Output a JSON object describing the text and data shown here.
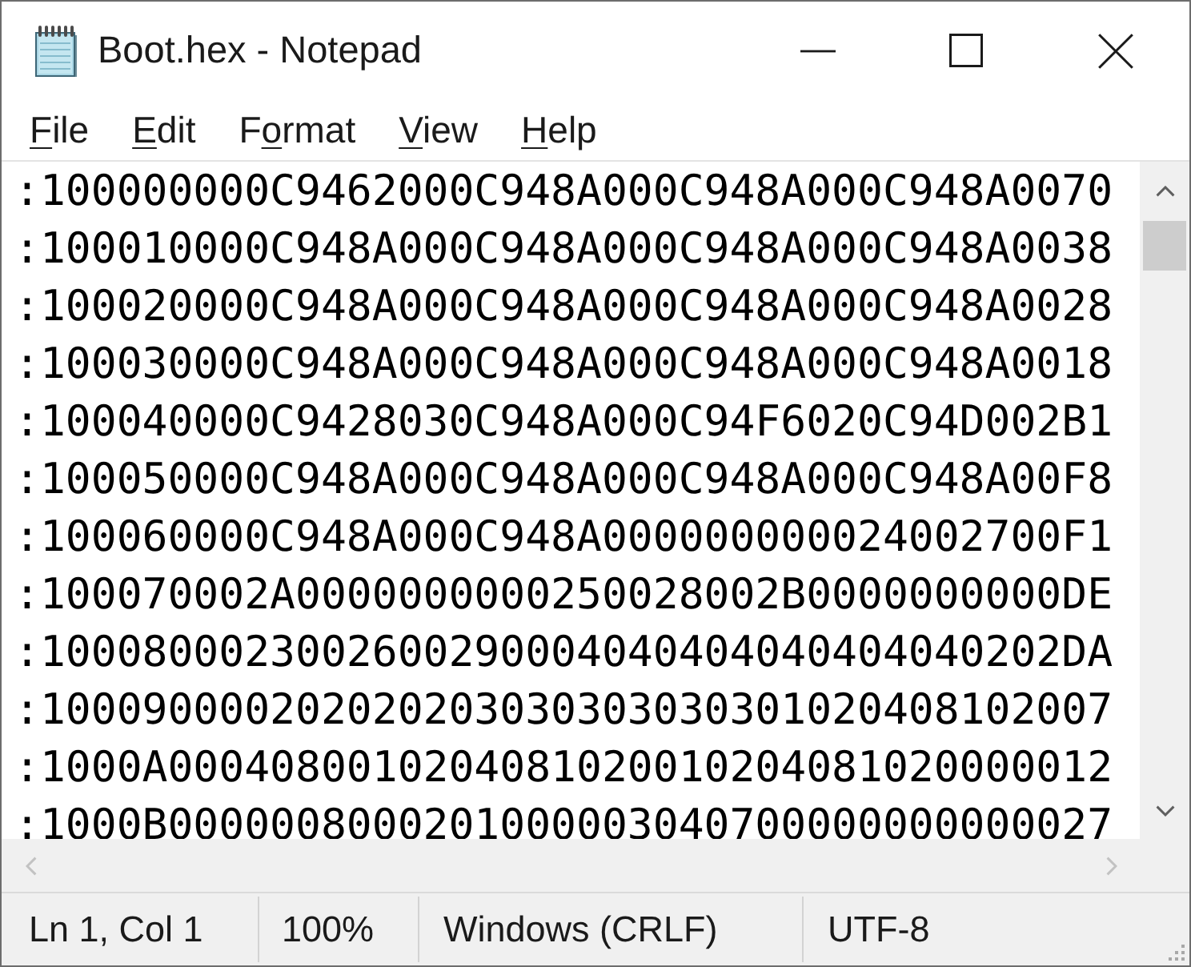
{
  "window": {
    "title": "Boot.hex - Notepad"
  },
  "menu": [
    {
      "parts": [
        {
          "text": "F",
          "underlined": true
        },
        {
          "text": "ile",
          "underlined": false
        }
      ]
    },
    {
      "parts": [
        {
          "text": "E",
          "underlined": true
        },
        {
          "text": "dit",
          "underlined": false
        }
      ]
    },
    {
      "parts": [
        {
          "text": "F",
          "underlined": false
        },
        {
          "text": "o",
          "underlined": true
        },
        {
          "text": "rmat",
          "underlined": false
        }
      ]
    },
    {
      "parts": [
        {
          "text": "V",
          "underlined": true
        },
        {
          "text": "iew",
          "underlined": false
        }
      ]
    },
    {
      "parts": [
        {
          "text": "H",
          "underlined": true
        },
        {
          "text": "elp",
          "underlined": false
        }
      ]
    }
  ],
  "editor": {
    "lines": [
      ":100000000C9462000C948A000C948A000C948A0070",
      ":100010000C948A000C948A000C948A000C948A0038",
      ":100020000C948A000C948A000C948A000C948A0028",
      ":100030000C948A000C948A000C948A000C948A0018",
      ":100040000C9428030C948A000C94F6020C94D002B1",
      ":100050000C948A000C948A000C948A000C948A00F8",
      ":100060000C948A000C948A000000000024002700F1",
      ":100070002A0000000000250028002B0000000000DE",
      ":1000800023002600290004040404040404040202DA",
      ":100090000202020203030303030301020408102007",
      ":1000A0004080010204081020010204081020000012",
      ":1000B0000008000201000003040700000000000027"
    ]
  },
  "vertical_scrollbar": {
    "disabled": false
  },
  "horizontal_scrollbar": {
    "disabled": true
  },
  "status_bar": {
    "position": "Ln 1, Col 1",
    "zoom": "100%",
    "line_endings": "Windows (CRLF)",
    "encoding": "UTF-8"
  }
}
